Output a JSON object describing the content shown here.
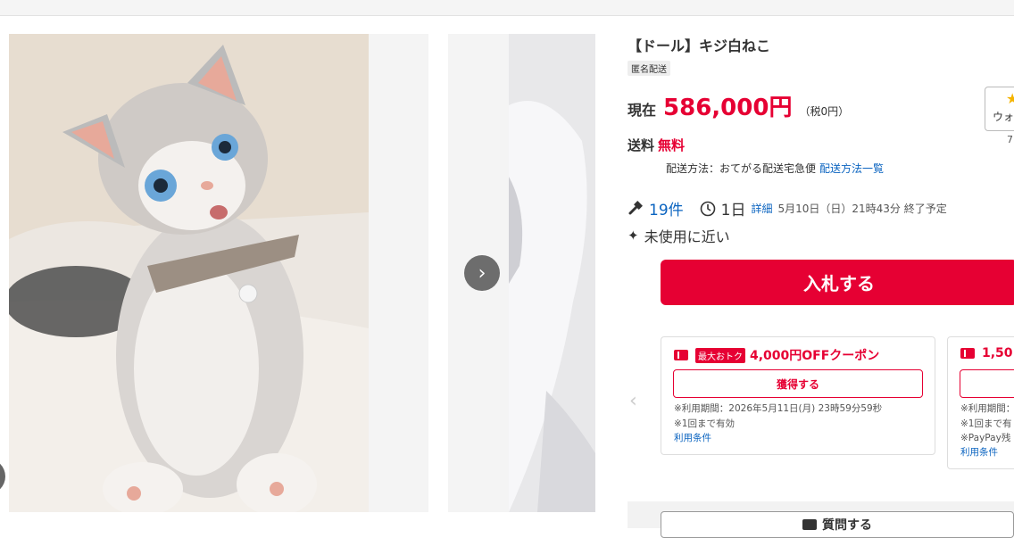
{
  "product": {
    "title": "【ドール】キジ白ねこ",
    "anon_badge": "匿名配送",
    "price_label": "現在",
    "price_value": "586,000円",
    "price_tax": "（税0円）"
  },
  "watch": {
    "label": "ウォ",
    "count": "7"
  },
  "shipping": {
    "label": "送料",
    "value": "無料",
    "method": "配送方法：おてがる配送宅急便",
    "method_link": "配送方法一覧"
  },
  "meta": {
    "bids": "19件",
    "days": "1日",
    "detail_link": "詳細",
    "end_time": "5月10日（日）21時43分 終了予定"
  },
  "condition": "未使用に近い",
  "bid_button": "入札する",
  "coupons": [
    {
      "badge": "最大おトク",
      "title": "4,000円OFFクーポン",
      "button": "獲得する",
      "period": "※利用期間：2026年5月11日(月) 23時59分59秒",
      "limit": "※1回まで有効",
      "terms": "利用条件"
    },
    {
      "title": "1,50",
      "period": "※利用期間：",
      "limit": "※1回まで有",
      "extra": "※PayPay残",
      "terms": "利用条件"
    }
  ],
  "ask_button": "質問する",
  "colors": {
    "accent": "#e60033",
    "link": "#0b64c0"
  }
}
